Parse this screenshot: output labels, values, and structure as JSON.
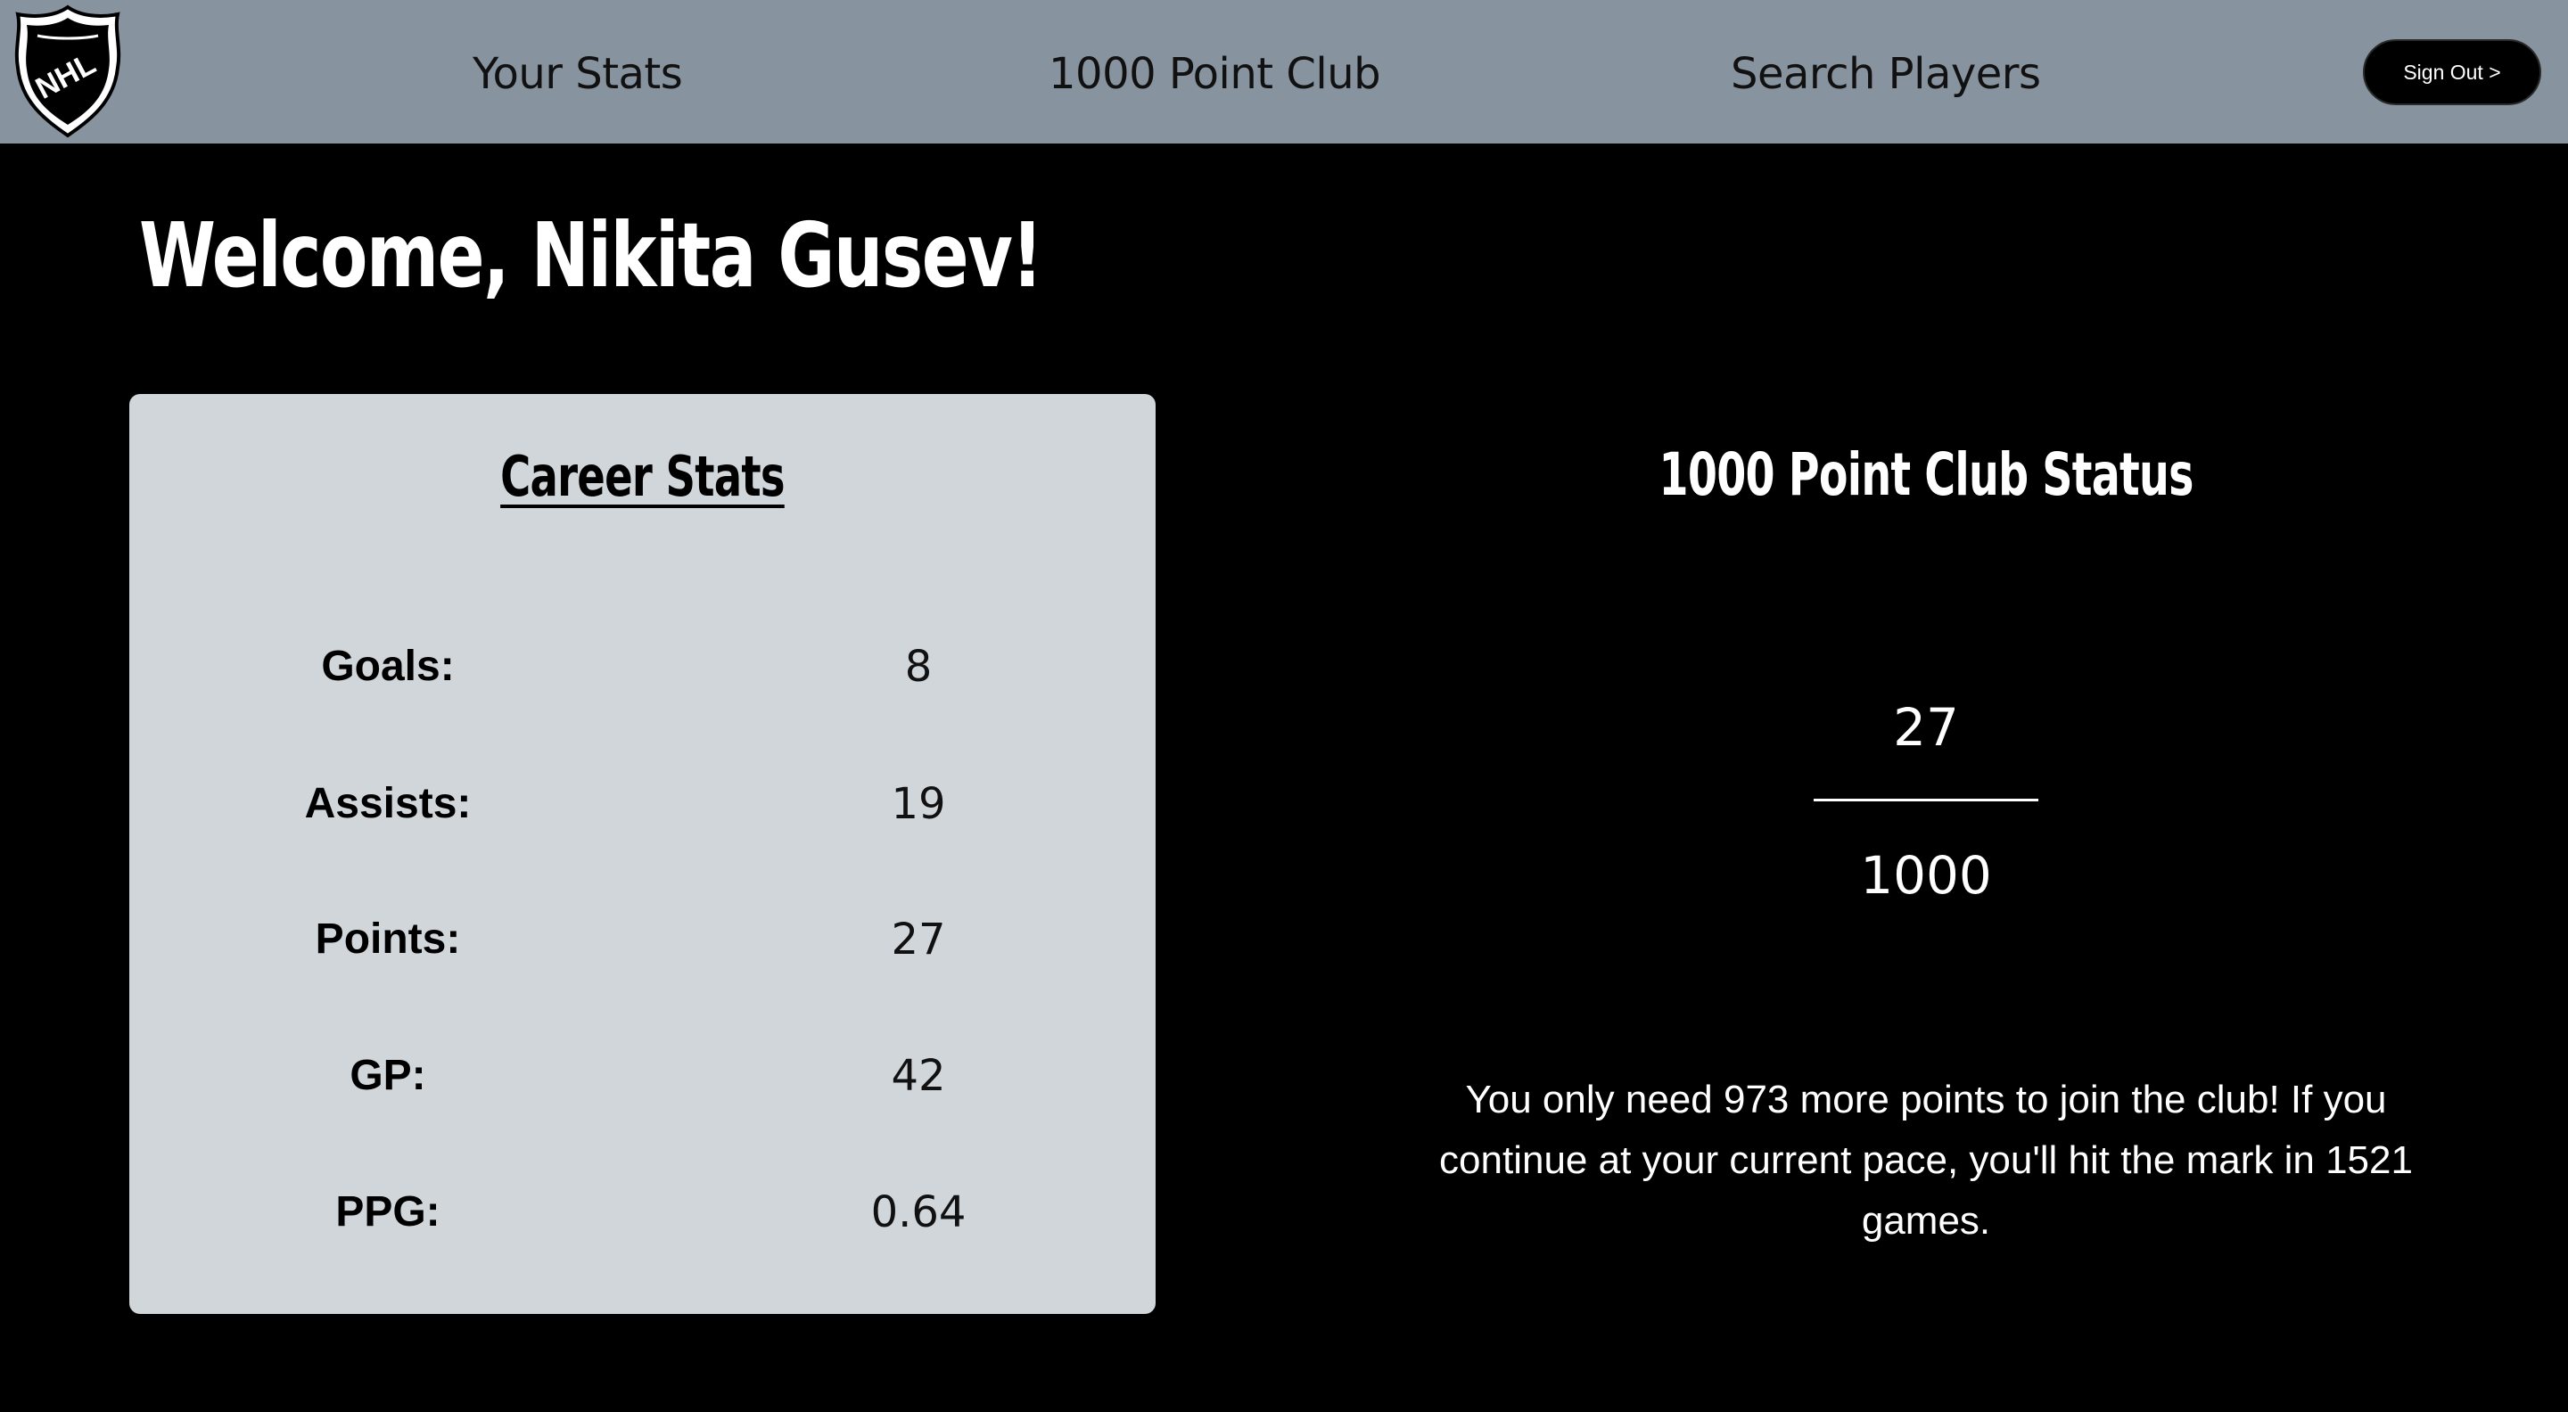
{
  "nav": {
    "logo_text": "NHL",
    "links": [
      "Your Stats",
      "1000 Point Club",
      "Search Players"
    ],
    "sign_out": "Sign Out >"
  },
  "welcome": "Welcome, Nikita Gusev!",
  "career": {
    "title": "Career Stats",
    "stats": [
      {
        "label": "Goals:",
        "value": "8"
      },
      {
        "label": "Assists:",
        "value": "19"
      },
      {
        "label": "Points:",
        "value": "27"
      },
      {
        "label": "GP:",
        "value": "42"
      },
      {
        "label": "PPG:",
        "value": "0.64"
      }
    ]
  },
  "club": {
    "title": "1000 Point Club Status",
    "numerator": "27",
    "denominator": "1000",
    "message": "You only need 973 more points to join the club! If you continue at your current pace, you'll hit the mark in 1521 games."
  },
  "colors": {
    "navbar": "#87939e",
    "background": "#000000",
    "card": "#d1d6da"
  }
}
